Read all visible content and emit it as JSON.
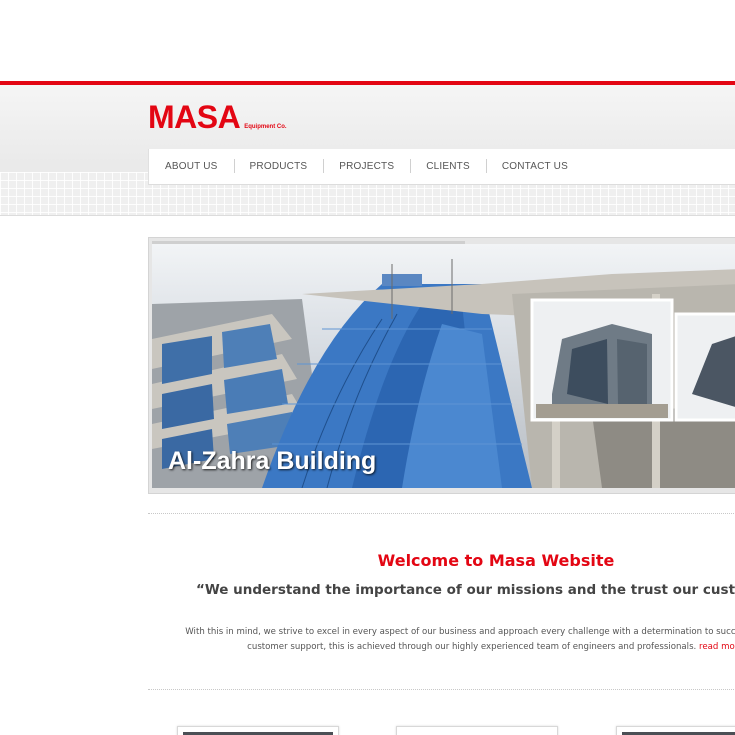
{
  "logo": {
    "name": "MASA",
    "subtitle": "Equipment Co."
  },
  "nav": {
    "items": [
      {
        "label": "ABOUT US"
      },
      {
        "label": "PRODUCTS"
      },
      {
        "label": "PROJECTS"
      },
      {
        "label": "CLIENTS"
      },
      {
        "label": "CONTACT US"
      }
    ]
  },
  "slider": {
    "caption": "Al-Zahra Building"
  },
  "welcome": {
    "title": "Welcome to Masa Website",
    "quote": "“We understand the importance of our missions and the trust our customers pla",
    "body_line1": "With this in mind, we strive to excel in every aspect of our business and approach every challenge with a determination to succeed. We em",
    "body_line2": "customer support, this is achieved through our highly experienced team of engineers and professionals.",
    "read_more": "read more.."
  },
  "colors": {
    "brand_red": "#e30613",
    "nav_text": "#555555",
    "body_text": "#555555"
  }
}
